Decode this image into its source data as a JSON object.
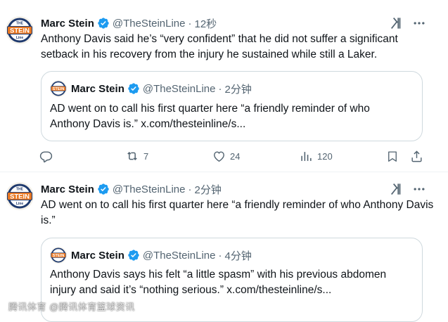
{
  "tweets": [
    {
      "author_name": "Marc Stein",
      "handle": "@TheSteinLine",
      "separator": "·",
      "time": "12秒",
      "avatar_text": {
        "top": "THE",
        "middle": "STEIN",
        "bottom": "Line"
      },
      "text": "Anthony Davis said he’s “very confident” that he did not suffer a significant setback in his recovery from the injury he sustained while still a Laker.",
      "quote": {
        "author_name": "Marc Stein",
        "handle": "@TheSteinLine",
        "separator": "·",
        "time": "2分钟",
        "text": "AD went on to call his first quarter here “a friendly reminder of who Anthony Davis is.” x.com/thesteinline/s..."
      },
      "actions": {
        "replies": "",
        "reposts": "7",
        "likes": "24",
        "views": "120"
      }
    },
    {
      "author_name": "Marc Stein",
      "handle": "@TheSteinLine",
      "separator": "·",
      "time": "2分钟",
      "avatar_text": {
        "top": "THE",
        "middle": "STEIN",
        "bottom": "Line"
      },
      "text": "AD went on to call his first quarter here “a friendly reminder of who Anthony Davis is.”",
      "quote": {
        "author_name": "Marc Stein",
        "handle": "@TheSteinLine",
        "separator": "·",
        "time": "4分钟",
        "text": "Anthony Davis says his felt “a little spasm” with his previous abdomen injury and said it’s “nothing serious.” x.com/thesteinline/s..."
      }
    }
  ],
  "icons": {
    "verified": "verified-badge-icon",
    "grok": "grok-icon",
    "more": "more-icon",
    "reply": "reply-icon",
    "repost": "repost-icon",
    "like": "like-icon",
    "views": "views-icon",
    "bookmark": "bookmark-icon",
    "share": "share-icon"
  },
  "colors": {
    "text": "#0f1419",
    "secondary": "#536471",
    "verified": "#1d9bf0",
    "border": "#cfd9de",
    "avatar_navy": "#1f3a6e",
    "avatar_orange": "#e87722"
  },
  "watermark": "腾讯体育 @腾讯体育篮球资讯"
}
